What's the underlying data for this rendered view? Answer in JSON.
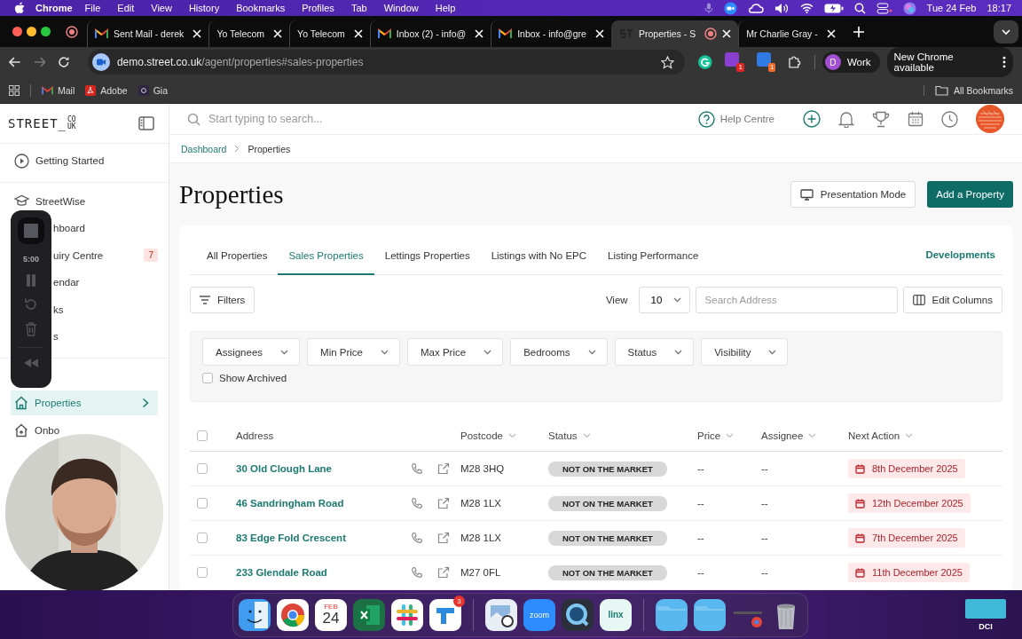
{
  "menubar": {
    "app": "Chrome",
    "menus": [
      "File",
      "Edit",
      "View",
      "History",
      "Bookmarks",
      "Profiles",
      "Tab",
      "Window",
      "Help"
    ],
    "date": "Tue 24 Feb",
    "time": "18:17"
  },
  "browser": {
    "tabs": [
      {
        "title": "Sent Mail - derek",
        "kind": "mail",
        "selected": false,
        "recording": false
      },
      {
        "title": "Yo Telecom",
        "kind": "plain",
        "selected": false,
        "recording": false
      },
      {
        "title": "Yo Telecom",
        "kind": "plain",
        "selected": false,
        "recording": false
      },
      {
        "title": "Inbox (2) - info@",
        "kind": "mail",
        "selected": false,
        "recording": false
      },
      {
        "title": "Inbox - info@gre",
        "kind": "mail",
        "selected": false,
        "recording": false
      },
      {
        "title": "Properties - S",
        "kind": "site",
        "selected": true,
        "recording": true
      },
      {
        "title": "Mr Charlie Gray -",
        "kind": "plain",
        "selected": false,
        "recording": false
      }
    ],
    "address": {
      "host": "demo.street.co.uk",
      "path": "/agent/properties#sales-properties"
    },
    "extension_badges": [
      "1",
      "1"
    ],
    "profile": {
      "initial": "D",
      "name": "Work"
    },
    "update_button": "New Chrome available",
    "bookmarks": [
      {
        "label": "Mail",
        "kind": "mail"
      },
      {
        "label": "Adobe",
        "kind": "pdf"
      },
      {
        "label": "Gia",
        "kind": "site"
      }
    ],
    "all_bookmarks": "All Bookmarks"
  },
  "recorder": {
    "timer": "5:00"
  },
  "app": {
    "logo": {
      "word": "STREET_",
      "suffix_top": "CO",
      "suffix_bottom": "UK"
    },
    "sidebar": [
      {
        "label": "Getting Started",
        "kind": "play",
        "selected": false
      },
      {
        "label": "StreetWise",
        "kind": "cap",
        "selected": false
      },
      {
        "label": "hboard",
        "kind": "covered",
        "selected": false
      },
      {
        "label": "uiry Centre",
        "kind": "covered",
        "selected": false,
        "badge": "7"
      },
      {
        "label": "endar",
        "kind": "covered",
        "selected": false
      },
      {
        "label": "ks",
        "kind": "covered",
        "selected": false
      },
      {
        "label": "s",
        "kind": "covered",
        "selected": false
      },
      {
        "label": "Properties",
        "kind": "home",
        "selected": true
      },
      {
        "label": "Onbo",
        "kind": "house-plus",
        "selected": false
      }
    ],
    "search": {
      "placeholder": "Start typing to search..."
    },
    "help": "Help Centre",
    "breadcrumb": [
      "Dashboard",
      "Properties"
    ],
    "title": "Properties",
    "presentation_button": "Presentation Mode",
    "add_button": "Add a Property",
    "tabs": [
      {
        "label": "All Properties",
        "selected": false
      },
      {
        "label": "Sales Properties",
        "selected": true
      },
      {
        "label": "Lettings Properties",
        "selected": false
      },
      {
        "label": "Listings with No EPC",
        "selected": false
      },
      {
        "label": "Listing Performance",
        "selected": false
      }
    ],
    "developments": "Developments",
    "filters_button": "Filters",
    "view_label": "View",
    "view_value": "10",
    "address_search": {
      "placeholder": "Search Address"
    },
    "edit_columns": "Edit Columns",
    "filter_dropdowns": [
      "Assignees",
      "Min Price",
      "Max Price",
      "Bedrooms",
      "Status",
      "Visibility"
    ],
    "show_archived": {
      "label": "Show Archived",
      "checked": false
    },
    "table": {
      "all_checked": false,
      "columns": [
        {
          "label": "Address",
          "sortable": false
        },
        {
          "label": "Postcode",
          "sortable": true
        },
        {
          "label": "Status",
          "sortable": true
        },
        {
          "label": "Price",
          "sortable": true
        },
        {
          "label": "Assignee",
          "sortable": true
        },
        {
          "label": "Next Action",
          "sortable": true
        }
      ],
      "rows": [
        {
          "checked": false,
          "address": "30 Old Clough Lane",
          "postcode": "M28 3HQ",
          "status": "NOT ON THE MARKET",
          "price": "--",
          "assignee": "--",
          "next_action": "8th December 2025"
        },
        {
          "checked": false,
          "address": "46 Sandringham Road",
          "postcode": "M28 1LX",
          "status": "NOT ON THE MARKET",
          "price": "--",
          "assignee": "--",
          "next_action": "12th December 2025"
        },
        {
          "checked": false,
          "address": "83 Edge Fold Crescent",
          "postcode": "M28 1LX",
          "status": "NOT ON THE MARKET",
          "price": "--",
          "assignee": "--",
          "next_action": "7th December 2025"
        },
        {
          "checked": false,
          "address": "233 Glendale Road",
          "postcode": "M27 0FL",
          "status": "NOT ON THE MARKET",
          "price": "--",
          "assignee": "--",
          "next_action": "11th December 2025"
        }
      ]
    }
  },
  "dock": {
    "items": [
      {
        "kind": "finder"
      },
      {
        "kind": "chrome"
      },
      {
        "kind": "calendar",
        "month": "FEB",
        "day": "24"
      },
      {
        "kind": "excel"
      },
      {
        "kind": "slack"
      },
      {
        "kind": "tasks",
        "badge": "3"
      },
      {
        "kind": "separator"
      },
      {
        "kind": "preview"
      },
      {
        "kind": "zoom",
        "label": "zoom"
      },
      {
        "kind": "quicktime"
      },
      {
        "kind": "linx",
        "label": "linx"
      },
      {
        "kind": "separator"
      },
      {
        "kind": "folder"
      },
      {
        "kind": "folder"
      },
      {
        "kind": "minimized"
      },
      {
        "kind": "trash"
      }
    ],
    "desktop_label": "DCI"
  }
}
